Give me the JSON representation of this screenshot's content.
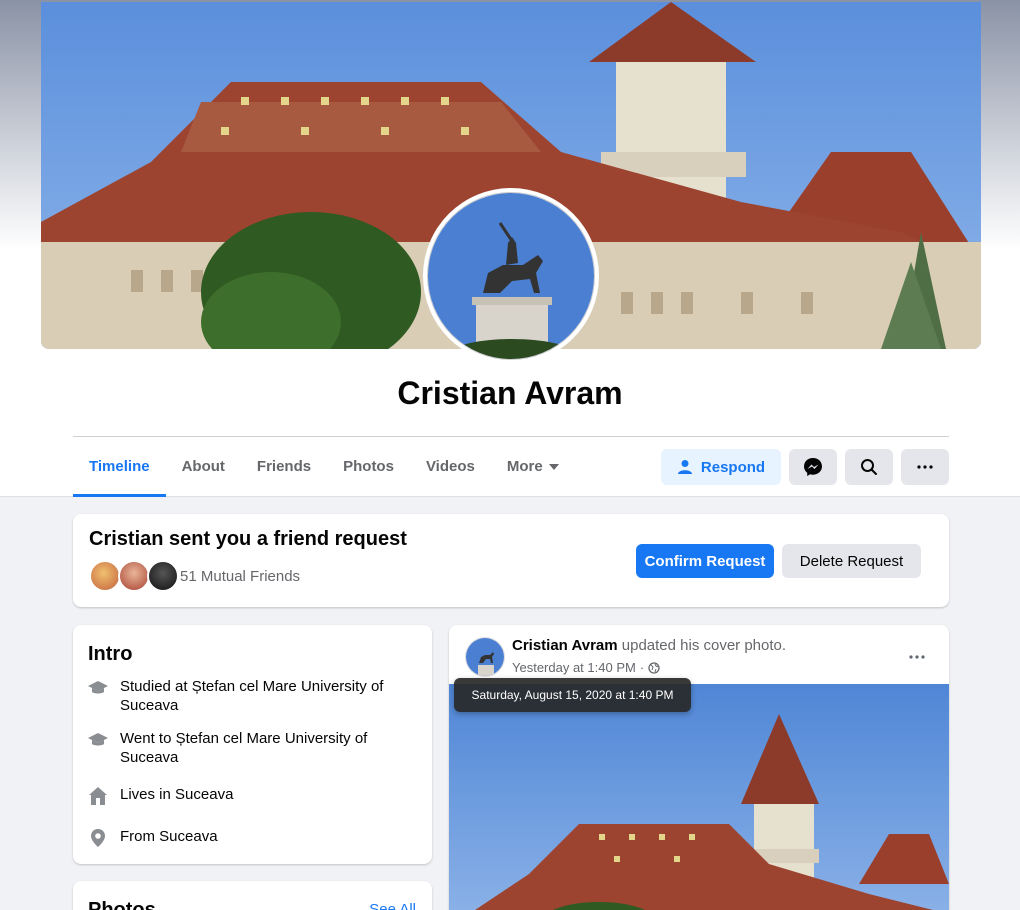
{
  "profile": {
    "name": "Cristian Avram"
  },
  "nav": {
    "tabs": [
      {
        "label": "Timeline"
      },
      {
        "label": "About"
      },
      {
        "label": "Friends"
      },
      {
        "label": "Photos"
      },
      {
        "label": "Videos"
      },
      {
        "label": "More"
      }
    ],
    "active_tab": "Timeline",
    "respond_label": "Respond",
    "icons": [
      "messenger-icon",
      "search-icon",
      "more-dots-icon"
    ]
  },
  "friend_request": {
    "title": "Cristian sent you a friend request",
    "mutual_friends": "51 Mutual Friends",
    "confirm_label": "Confirm Request",
    "delete_label": "Delete Request"
  },
  "intro": {
    "title": "Intro",
    "items": [
      {
        "icon": "graduation-cap-icon",
        "prefix": "Studied at ",
        "value": "Ștefan cel Mare University of Suceava"
      },
      {
        "icon": "graduation-cap-icon",
        "prefix": "Went to ",
        "value": "Ștefan cel Mare University of Suceava"
      },
      {
        "icon": "home-icon",
        "prefix": "Lives in ",
        "value": "Suceava"
      },
      {
        "icon": "location-pin-icon",
        "prefix": "From ",
        "value": "Suceava"
      }
    ]
  },
  "photos": {
    "title": "Photos",
    "see_all": "See All"
  },
  "post": {
    "author": "Cristian Avram",
    "action": "updated his cover photo.",
    "time": "Yesterday at 1:40 PM",
    "separator": "·",
    "tooltip": "Saturday, August 15, 2020 at 1:40 PM"
  },
  "colors": {
    "accent": "#1877f2",
    "accent_light": "#e7f3ff",
    "button_grey": "#e4e6eb",
    "page_bg": "#f0f2f5",
    "secondary_text": "#65676b"
  }
}
